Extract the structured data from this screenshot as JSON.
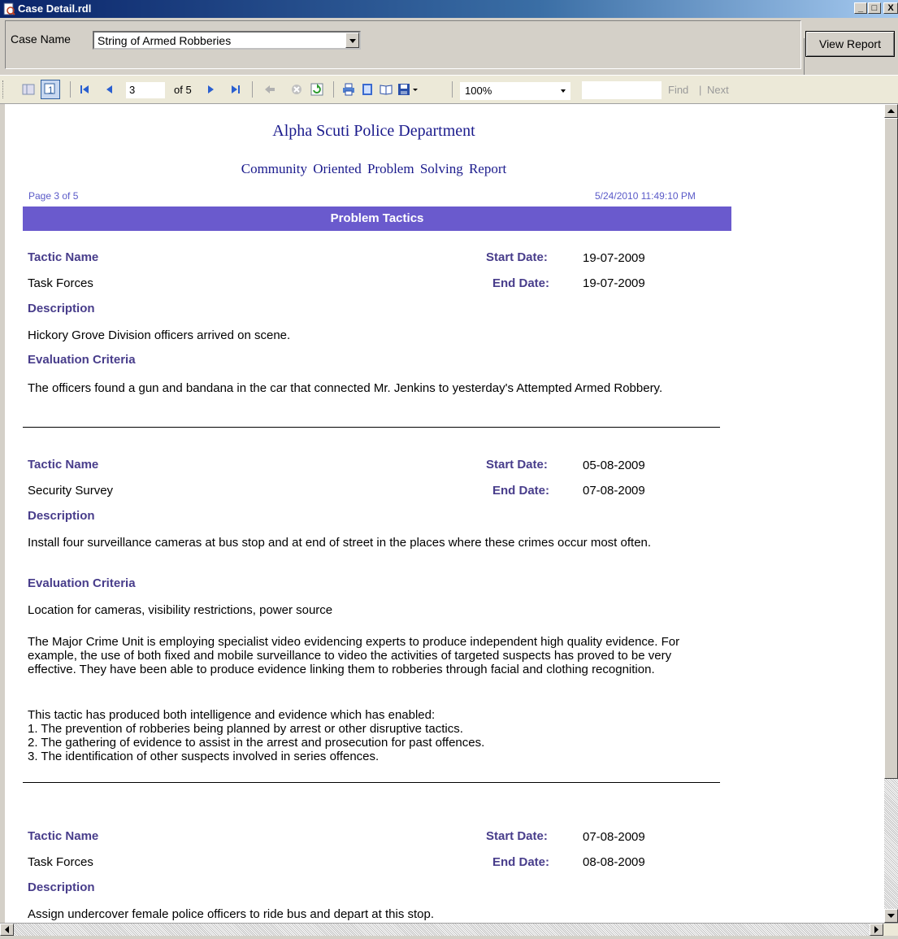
{
  "window": {
    "title": "Case Detail.rdl",
    "buttons": [
      "_",
      "□",
      "X"
    ]
  },
  "parameters": {
    "case_name_label": "Case Name",
    "case_name_value": "String of Armed Robberies",
    "view_report_label": "View Report"
  },
  "toolbar": {
    "current_page": "3",
    "page_of": "of 5",
    "zoom": "100%",
    "find_label": "Find",
    "find_sep": "|",
    "next_label": "Next",
    "icons": [
      "document-map-icon",
      "parameters-icon",
      "first-page-icon",
      "previous-page-icon",
      "next-page-icon",
      "last-page-icon",
      "back-icon",
      "stop-icon",
      "refresh-icon",
      "print-icon",
      "print-layout-icon",
      "page-setup-icon",
      "export-icon"
    ]
  },
  "report": {
    "department": "Alpha Scuti Police Department",
    "subtitle": "Community Oriented Problem Solving Report",
    "page_info": "Page 3 of 5",
    "timestamp": "5/24/2010 11:49:10 PM",
    "section_title": "Problem Tactics",
    "labels": {
      "tactic_name": "Tactic Name",
      "start_date": "Start Date:",
      "end_date": "End Date:",
      "description": "Description",
      "evaluation": "Evaluation Criteria"
    },
    "tactics": [
      {
        "name": "Task Forces",
        "start": "19-07-2009",
        "end": "19-07-2009",
        "description": "Hickory Grove Division officers arrived on scene.",
        "evaluation": "The officers found a gun and bandana in the car that connected Mr. Jenkins to yesterday's Attempted Armed Robbery."
      },
      {
        "name": "Security Survey",
        "start": "05-08-2009",
        "end": "07-08-2009",
        "description": "Install four surveillance cameras at bus stop and at end of street in the places where these crimes occur most often.",
        "evaluation": "Location for cameras, visibility restrictions, power source",
        "evaluation_more": "The Major Crime Unit is employing specialist video evidencing experts to produce independent high quality evidence. For example, the use of both fixed and mobile surveillance to video the activities of targeted suspects has proved to be very effective. They have been able to produce evidence linking them to robberies through facial and clothing recognition.",
        "evaluation_list": "This tactic has produced both intelligence and evidence which has enabled:\n1. The prevention of robberies being planned by arrest or other disruptive tactics.\n2. The gathering of evidence to assist in the arrest and prosecution for past offences.\n3. The identification of other suspects involved in series offences."
      },
      {
        "name": "Task Forces",
        "start": "07-08-2009",
        "end": "08-08-2009",
        "description": "Assign undercover female police officers to ride bus and depart at this stop."
      }
    ]
  }
}
